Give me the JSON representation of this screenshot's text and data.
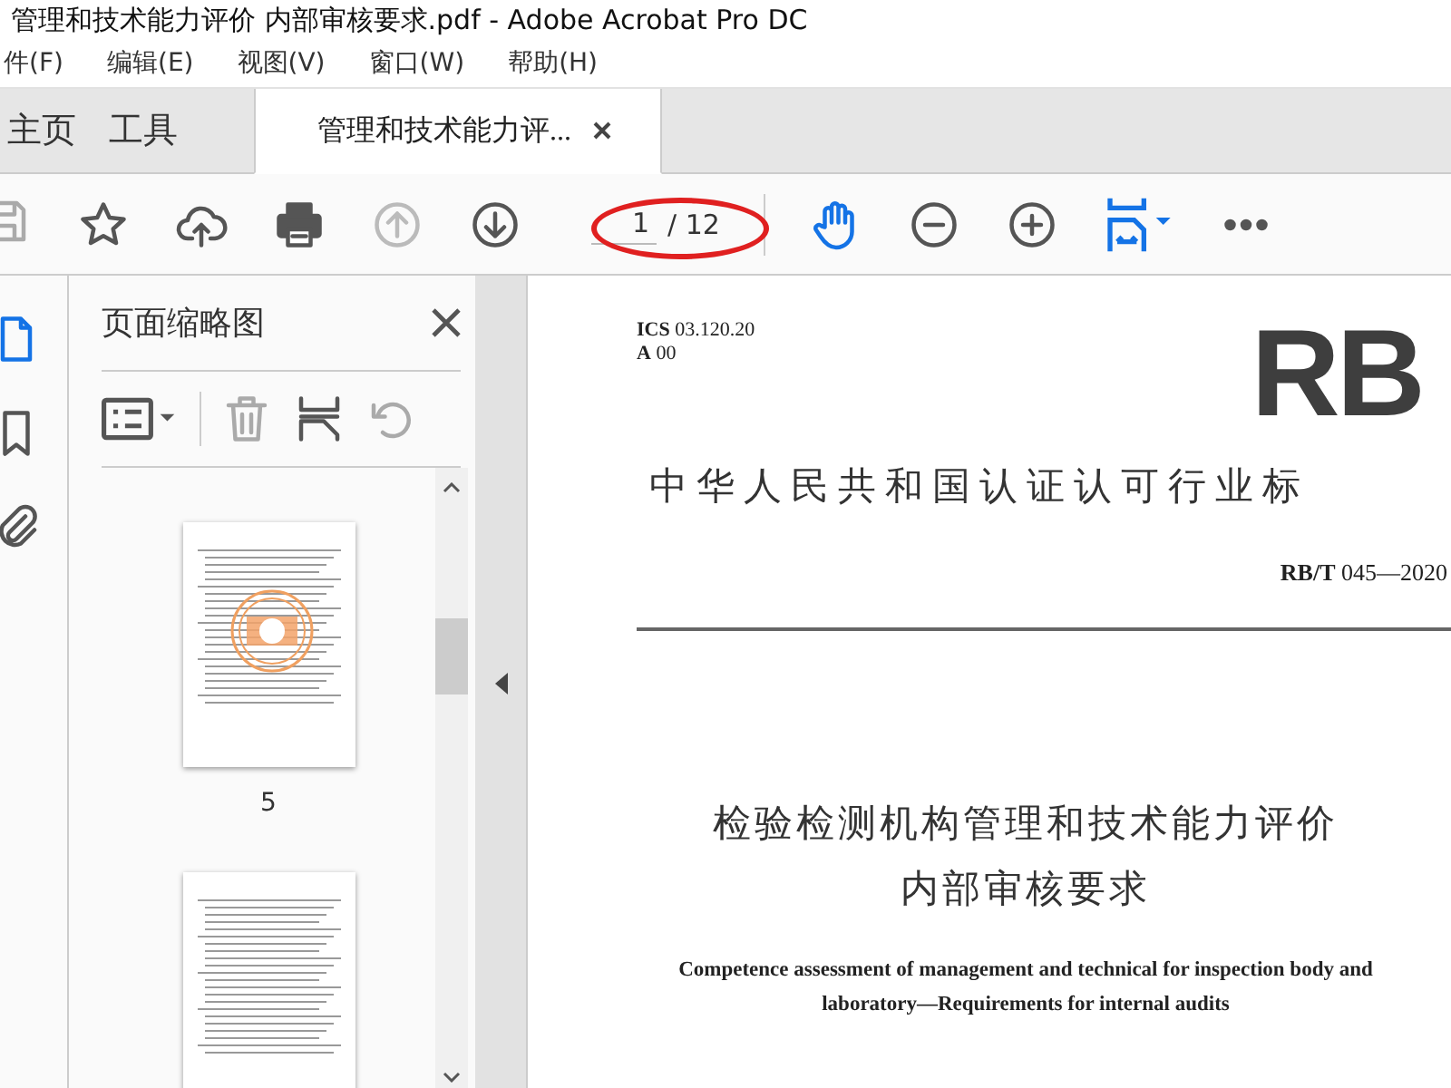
{
  "window": {
    "title": "管理和技术能力评价 内部审核要求.pdf - Adobe Acrobat Pro DC"
  },
  "menu": [
    "件(F)",
    "编辑(E)",
    "视图(V)",
    "窗口(W)",
    "帮助(H)"
  ],
  "tabs": [
    {
      "label": "主页",
      "selected": false,
      "kind": "nav"
    },
    {
      "label": "工具",
      "selected": false,
      "kind": "nav"
    },
    {
      "label": "管理和技术能力评...",
      "selected": true,
      "kind": "document"
    }
  ],
  "toolbar": {
    "page_number": "1",
    "page_count": "/ 12"
  },
  "rail": [
    {
      "kind": "pages",
      "selected": true
    },
    {
      "kind": "bookmarks",
      "selected": false
    },
    {
      "kind": "attachments",
      "selected": false
    }
  ],
  "side_panel": {
    "title": "页面缩略图",
    "thumbnails": [
      {
        "label": "5",
        "stamped": true
      },
      {
        "stamped": false
      }
    ]
  },
  "document": {
    "code_lines": [
      "**ICS** 03.120.20",
      "**A** 00"
    ],
    "logo": "RB",
    "org_title": "中华人民共和国认证认可行业标",
    "number": "**RB/T** 045—2020",
    "title_lines": [
      "检验检测机构管理和技术能力评价",
      "内部审核要求"
    ],
    "english_title": [
      "Competence assessment of management and technical for inspection body and",
      "laboratory—Requirements for internal audits"
    ]
  }
}
